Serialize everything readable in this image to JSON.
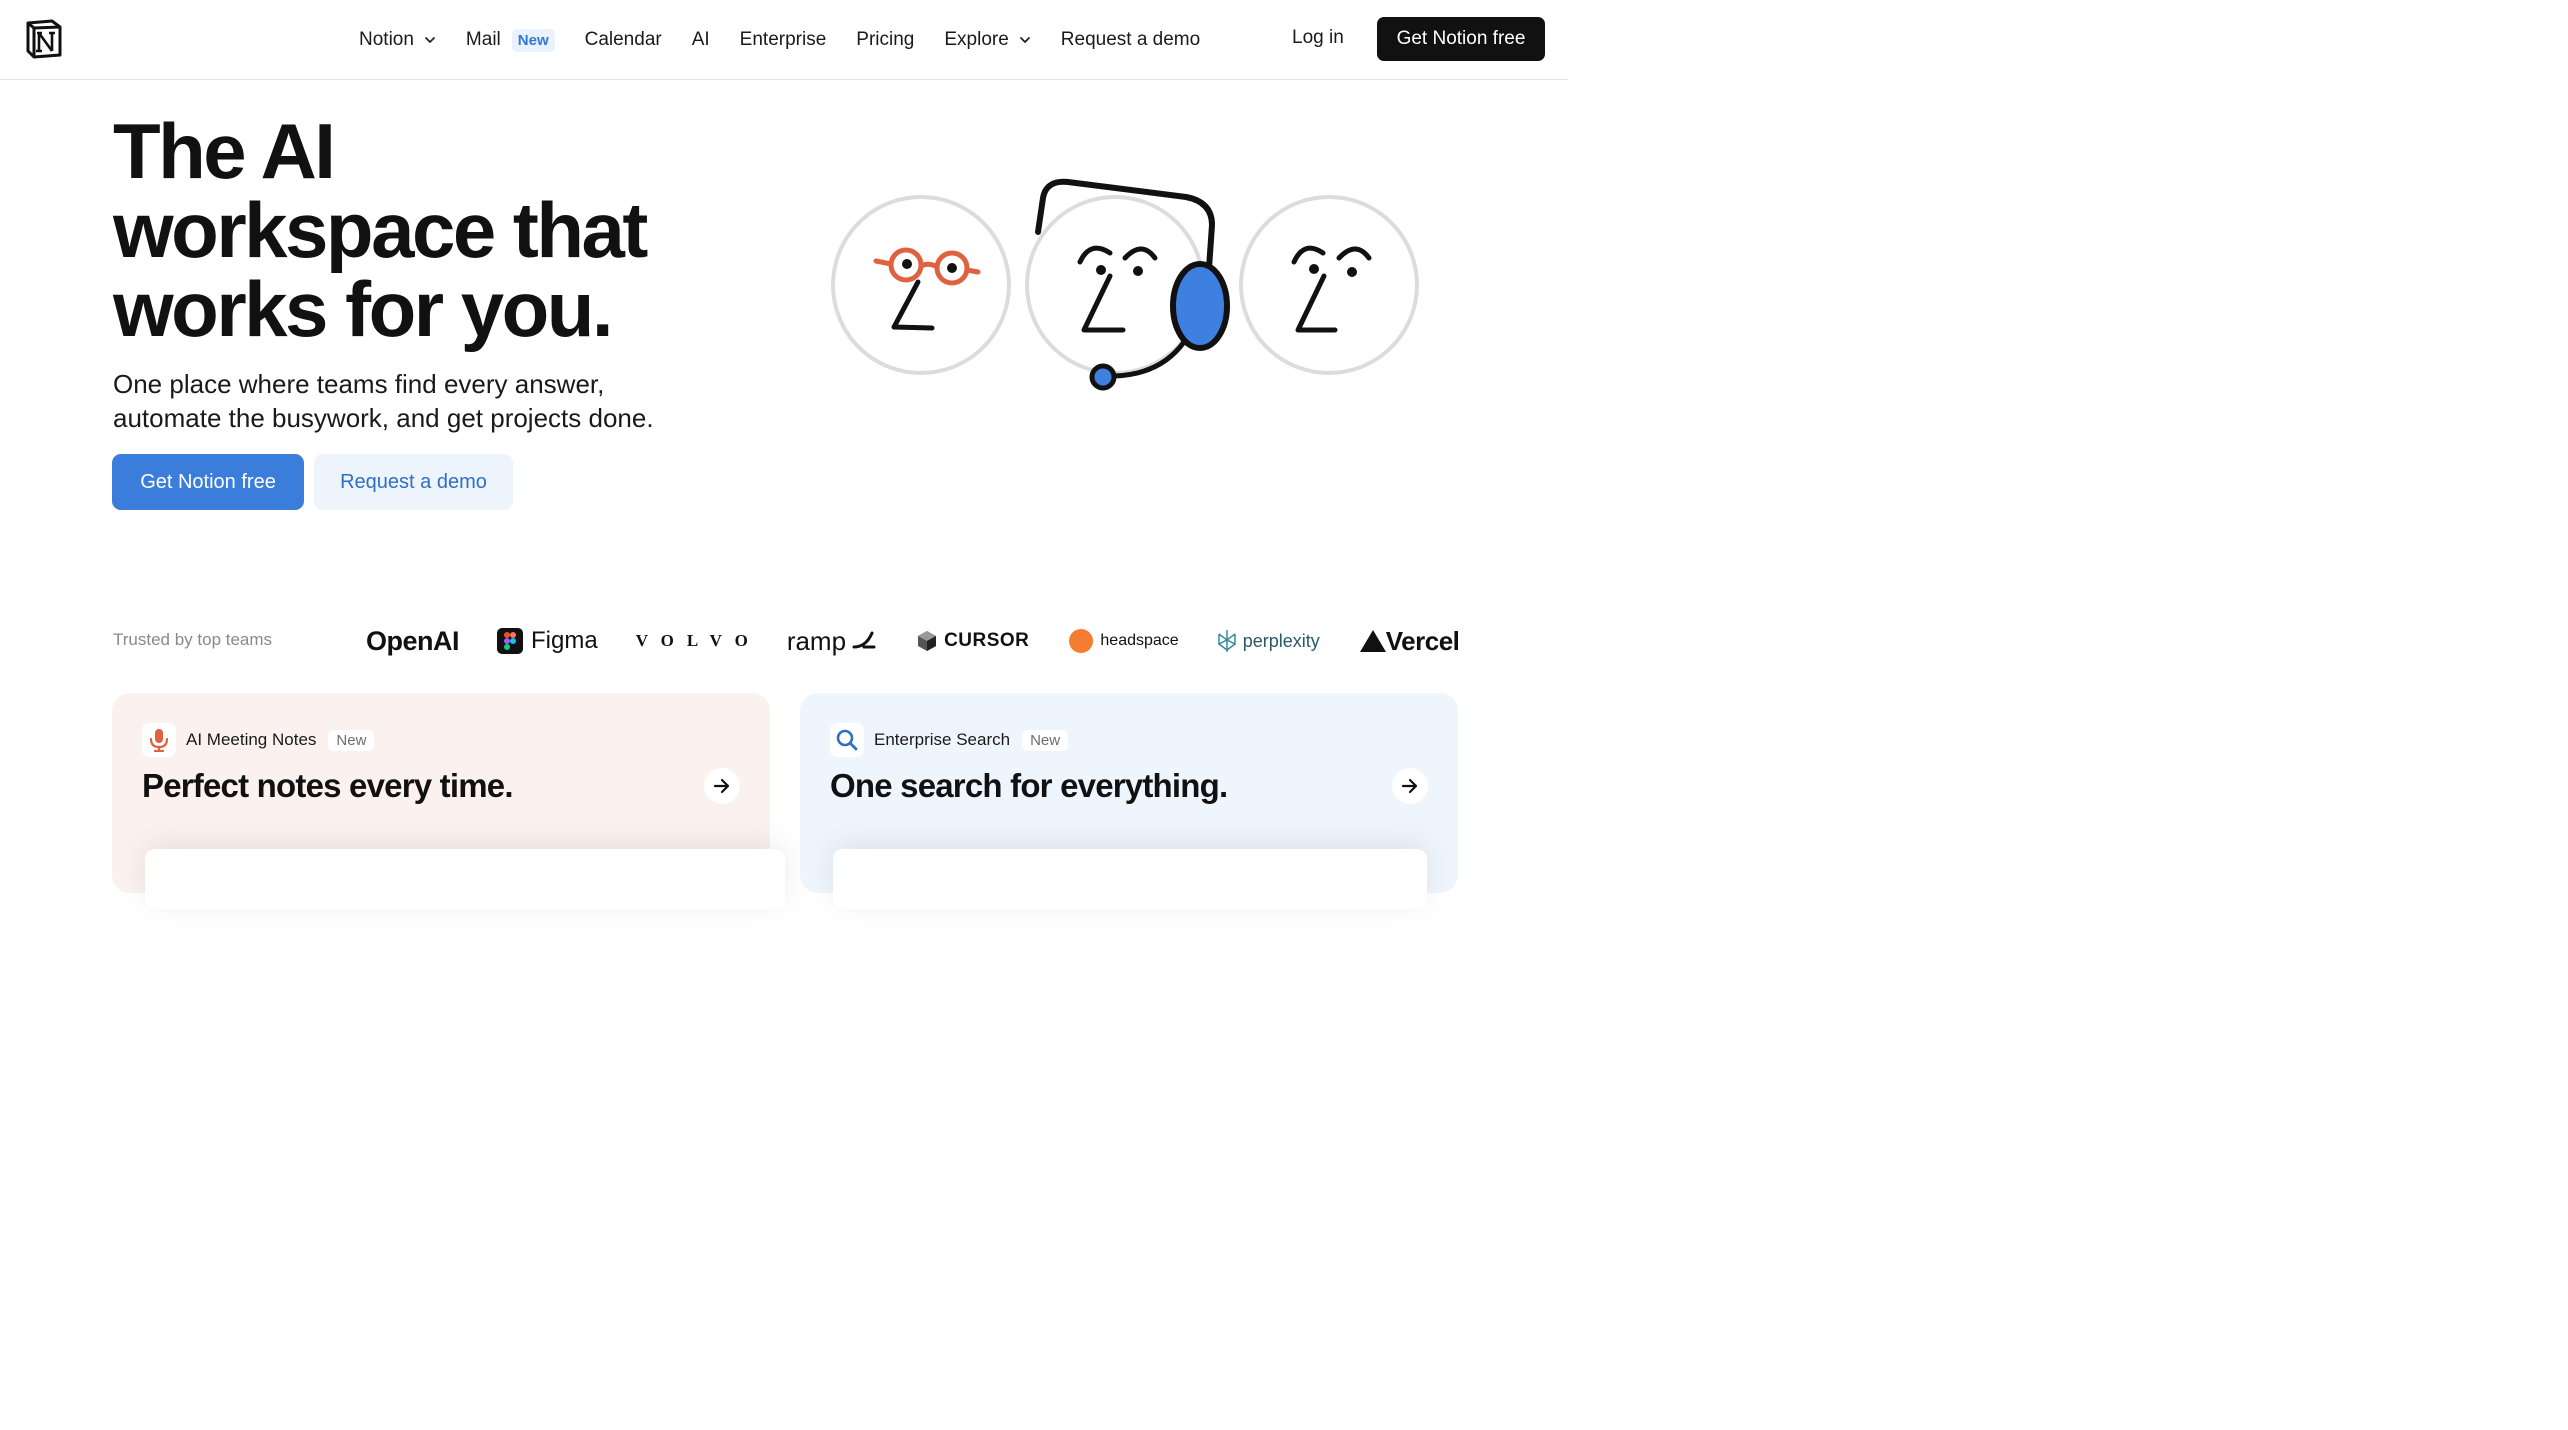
{
  "header": {
    "nav": [
      {
        "label": "Notion",
        "dropdown": true
      },
      {
        "label": "Mail",
        "badge": "New"
      },
      {
        "label": "Calendar"
      },
      {
        "label": "AI"
      },
      {
        "label": "Enterprise"
      },
      {
        "label": "Pricing"
      },
      {
        "label": "Explore",
        "dropdown": true
      },
      {
        "label": "Request a demo"
      }
    ],
    "login": "Log in",
    "cta": "Get Notion free"
  },
  "hero": {
    "title_line1": "The AI",
    "title_line2": "workspace that",
    "title_line3": "works for you.",
    "subtitle_line1": "One place where teams find every answer,",
    "subtitle_line2": "automate the busywork, and get projects done.",
    "primary_cta": "Get Notion free",
    "secondary_cta": "Request a demo"
  },
  "trusted": {
    "label": "Trusted by top teams",
    "logos": [
      "OpenAI",
      "Figma",
      "VOLVO",
      "ramp",
      "CURSOR",
      "headspace",
      "perplexity",
      "Vercel"
    ]
  },
  "cards": [
    {
      "tag": "AI Meeting Notes",
      "badge": "New",
      "title": "Perfect notes every time.",
      "icon": "microphone-icon"
    },
    {
      "tag": "Enterprise Search",
      "badge": "New",
      "title": "One search for everything.",
      "icon": "search-icon"
    }
  ],
  "colors": {
    "primary_blue": "#3a7ddb",
    "dark_button": "#111111",
    "card_pink": "#fbf1ee",
    "card_blue": "#eef5fc",
    "accent_orange": "#e0613f",
    "headspace_orange": "#f47d31"
  }
}
